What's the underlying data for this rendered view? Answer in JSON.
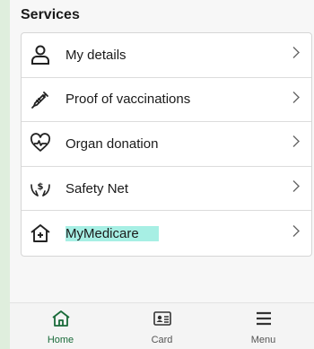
{
  "section": {
    "title": "Services"
  },
  "services": [
    {
      "label": "My details",
      "icon": "person-icon"
    },
    {
      "label": "Proof of vaccinations",
      "icon": "syringe-icon"
    },
    {
      "label": "Organ donation",
      "icon": "heart-pulse-icon"
    },
    {
      "label": "Safety Net",
      "icon": "hands-dollar-icon"
    },
    {
      "label": "MyMedicare",
      "icon": "house-plus-icon",
      "highlighted": true
    }
  ],
  "bottom_nav": {
    "items": [
      {
        "label": "Home",
        "icon": "home-icon",
        "active": true
      },
      {
        "label": "Card",
        "icon": "card-icon"
      },
      {
        "label": "Menu",
        "icon": "menu-icon"
      }
    ]
  },
  "colors": {
    "accent": "#1a6b3a",
    "highlight": "#a7efe4",
    "outer_bg": "#dfeedd"
  }
}
